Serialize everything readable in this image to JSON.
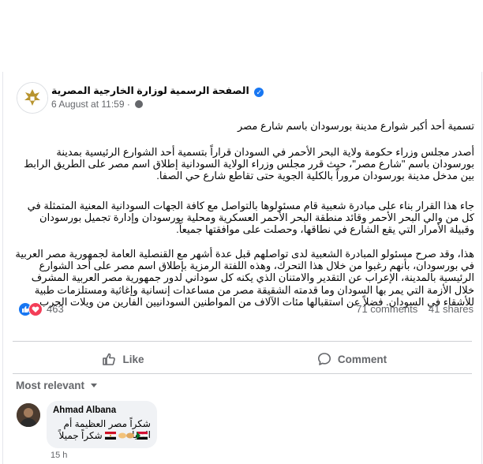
{
  "post": {
    "page_name": "الصفحة الرسمية لوزارة الخارجية المصرية",
    "timestamp": "6 August at 11:59",
    "title": "تسمية أحد أكبر شوارع مدينة بورسودان باسم شارع مصر",
    "paragraphs": [
      "أصدر مجلس وزراء حكومة ولاية البحر الأحمر في السودان قراراً بتسمية أحد الشوارع الرئيسية بمدينة بورسودان باسم \"شارع مصر\"، حيث قرر مجلس وزراء الولاية السودانية إطلاق اسم مصر على الطريق الرابط بين مدخل مدينة بورسودان مروراً بالكلية الجوية حتى تقاطع شارع حي الصفا.",
      "جاء هذا القرار بناء على مبادرة شعبية قام مسئولوها بالتواصل مع كافة الجهات السودانية المعنية المتمثلة في كل من والي البحر الأحمر وقائد منطقة البحر الأحمر العسكرية ومحلية بورسودان وإدارة تجميل بورسودان وقبيلة الأمرار التي يقع الشارع في نطاقها، وحصلت على موافقتها جميعاً.",
      "هذا، وقد صرح مسئولو المبادرة الشعبية لدى تواصلهم قبل عدة أشهر مع القنصلية العامة لجمهورية مصر العربية في بورسودان، بأنهم رغبوا من خلال هذا التحرك، وهذه اللفتة الرمزية بإطلاق اسم مصر على أحد الشوارع الرئيسية بالمدينة، الإعراب عن التقدير والامتنان الذي يكنه كل سوداني لدور جمهورية مصر العربية المشرف خلال الأزمة التي يمر بها السودان وما قدمته الشقيقة مصر من مساعدات إنسانية وإغاثية ومستلزمات طبية للأشقاء في السودان. فضلاً عن استقبالها مئات الآلاف من المواطنين السودانيين الفارين من ويلات الحرب."
    ]
  },
  "engagement": {
    "reaction_count": "463",
    "comments_count": "71 comments",
    "shares_count": "41 shares"
  },
  "actions": {
    "like_label": "Like",
    "comment_label": "Comment"
  },
  "comments_section": {
    "sort_label": "Most relevant",
    "comment": {
      "author": "Ahmad Albana",
      "line1": "شكراً مصر العظيمة أم الدنيا",
      "line2": "شكراً جميلاً",
      "time": "15 h"
    }
  },
  "colors": {
    "accent": "#1877f2",
    "love": "#f33e58",
    "secondary_text": "#65676b"
  }
}
